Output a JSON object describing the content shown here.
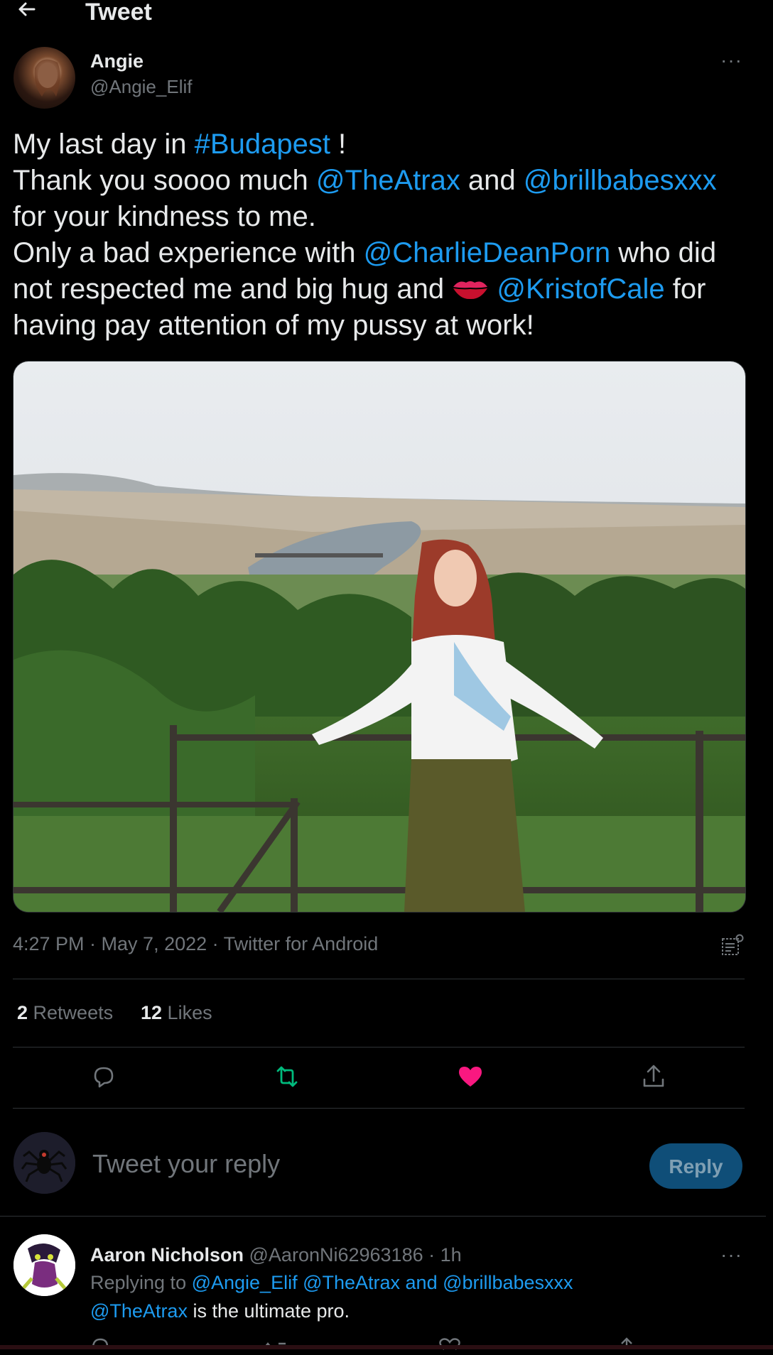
{
  "header": {
    "title": "Tweet",
    "back_icon": "arrow-left-icon"
  },
  "author": {
    "name": "Angie",
    "handle": "@Angie_Elif"
  },
  "tweet": {
    "segments": [
      {
        "text": "My last day in ",
        "link": false
      },
      {
        "text": "#Budapest",
        "link": true
      },
      {
        "text": " !\nThank you soooo much ",
        "link": false
      },
      {
        "text": "@TheAtrax",
        "link": true
      },
      {
        "text": " and ",
        "link": false
      },
      {
        "text": "@brillbabesxxx",
        "link": true
      },
      {
        "text": "\nfor your kindness to me.\nOnly a bad experience with ",
        "link": false
      },
      {
        "text": "@CharlieDeanPorn",
        "link": true
      },
      {
        "text": " who did\nnot respected me and big hug and ",
        "link": false
      },
      {
        "emoji": "kiss-mark-icon"
      },
      {
        "text": " ",
        "link": false
      },
      {
        "text": "@KristofCale",
        "link": true
      },
      {
        "text": " for\nhaving pay attention of my pussy at work!",
        "link": false
      }
    ],
    "meta": "4:27 PM · May 7, 2022 · Twitter for Android",
    "photo_alt": "Woman standing at a railing overlooking the Danube in Budapest"
  },
  "stats": {
    "retweets_count": "2",
    "retweets_label": " Retweets",
    "likes_count": "12",
    "likes_label": " Likes"
  },
  "actions": {
    "reply_icon": "comment-icon",
    "retweet_icon": "retweet-icon",
    "like_icon": "heart-filled-icon",
    "share_icon": "share-icon",
    "retweet_color": "#00ba7c",
    "like_color": "#f91880"
  },
  "composer": {
    "placeholder": "Tweet your reply",
    "button": "Reply"
  },
  "comment": {
    "name": "Aaron Nicholson",
    "handle_time": " @AaronNi62963186 · 1h",
    "replying_prefix": "Replying to ",
    "replying_to": "@Angie_Elif @TheAtrax and @brillbabesxxx",
    "body_link": "@TheAtrax",
    "body_text": " is the ultimate pro."
  },
  "colors": {
    "background": "#000000",
    "link": "#1d9bf0",
    "text": "#e7e9ea",
    "muted": "#71767b"
  }
}
